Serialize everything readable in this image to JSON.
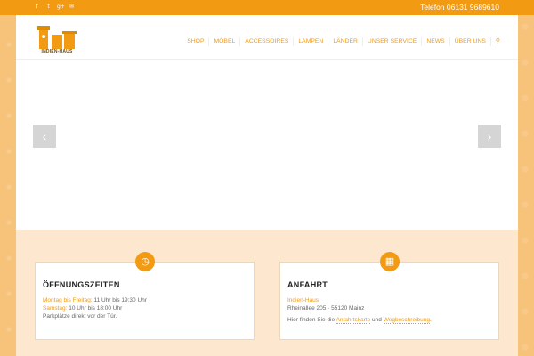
{
  "topbar": {
    "social": [
      {
        "icon": "facebook-icon",
        "glyph": "f"
      },
      {
        "icon": "twitter-icon",
        "glyph": "t"
      },
      {
        "icon": "google-plus-icon",
        "glyph": "g+"
      },
      {
        "icon": "mail-icon",
        "glyph": "✉"
      }
    ],
    "phone": "Telefon 06131 9689610"
  },
  "header": {
    "logo_name": "INDIEN-HAUS",
    "nav": [
      "SHOP",
      "MÖBEL",
      "ACCESSOIRES",
      "LAMPEN",
      "LÄNDER",
      "UNSER SERVICE",
      "NEWS",
      "ÜBER UNS"
    ]
  },
  "slider": {
    "prev": "‹",
    "next": "›"
  },
  "cards": {
    "hours": {
      "icon": "clock-icon",
      "title": "ÖFFNUNGSZEITEN",
      "line1_label": "Montag bis Freitag:",
      "line1_value": " 11 Uhr bis 19:30 Uhr",
      "line2_label": "Samstag:",
      "line2_value": " 10 Uhr bis 18:00 Uhr",
      "line3": "Parkplätze direkt vor der Tür."
    },
    "directions": {
      "icon": "map-icon",
      "title": "ANFAHRT",
      "name": "Indien-Haus",
      "address": "Rheinallee 205 · 55120 Mainz",
      "text_pre": "Hier finden Sie die ",
      "link1": "Anfahrtskarte",
      "text_mid": " und ",
      "link2": "Wegbeschreibung",
      "text_post": "."
    }
  },
  "colors": {
    "accent": "#f29a12",
    "background": "#f7c27a",
    "lower_bg": "#fde8cf"
  }
}
